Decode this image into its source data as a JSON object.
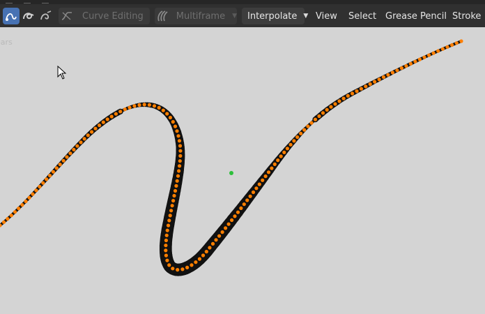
{
  "toolbar": {
    "mode_buttons": [
      {
        "icon": "curve-draw-icon",
        "active": true
      },
      {
        "icon": "curve-stroke-icon",
        "active": false
      },
      {
        "icon": "curve-sculpt-icon",
        "active": false
      }
    ],
    "curve_editing": {
      "label": "Curve Editing",
      "icon": "curve-editing-icon",
      "enabled": false
    },
    "multiframe": {
      "label": "Multiframe",
      "icon": "multiframe-icon",
      "enabled": false
    },
    "interpolate": {
      "label": "Interpolate"
    },
    "menus": [
      "View",
      "Select",
      "Grease Pencil",
      "Stroke"
    ]
  },
  "viewport": {
    "overlay_text": "ears",
    "background": "#d4d4d4",
    "stroke_color": "#111111",
    "point_color": "#ff7f00",
    "origin_color": "#2dbf3a"
  },
  "colors": {
    "toolbar_bg": "#303030",
    "accent": "#4772b3"
  }
}
